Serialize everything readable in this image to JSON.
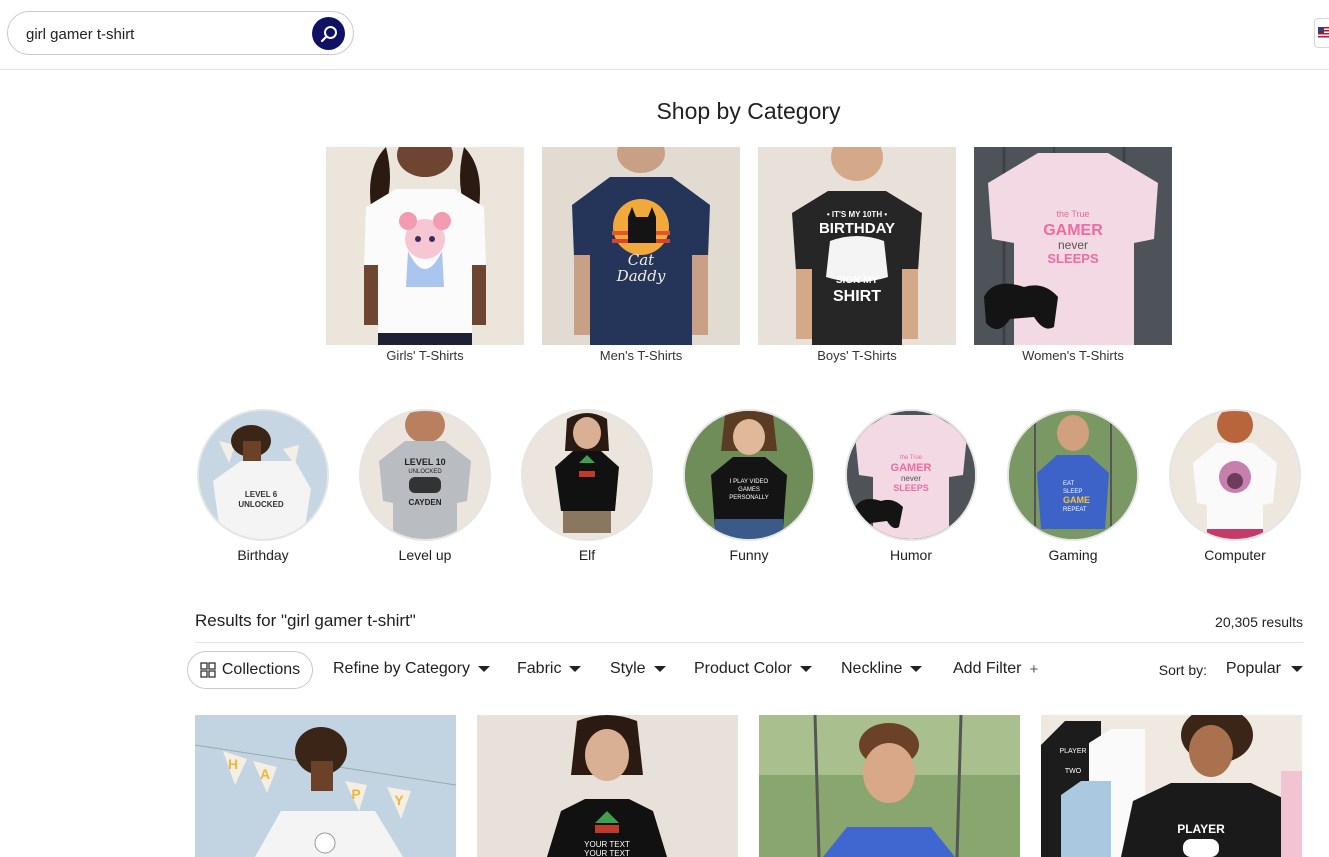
{
  "search": {
    "value": "girl gamer t-shirt",
    "button_icon": "search-icon"
  },
  "section": {
    "title": "Shop by Category"
  },
  "categories": [
    {
      "label": "Girls' T-Shirts"
    },
    {
      "label": "Men's T-Shirts"
    },
    {
      "label": "Boys' T-Shirts"
    },
    {
      "label": "Women's T-Shirts"
    }
  ],
  "collections_circles": [
    {
      "label": "Birthday"
    },
    {
      "label": "Level up"
    },
    {
      "label": "Elf"
    },
    {
      "label": "Funny"
    },
    {
      "label": "Humor"
    },
    {
      "label": "Gaming"
    },
    {
      "label": "Computer"
    }
  ],
  "results": {
    "title": "Results for \"girl gamer t-shirt\"",
    "count": "20,305 results"
  },
  "filters": {
    "collections": "Collections",
    "items": [
      "Refine by Category",
      "Fabric",
      "Style",
      "Product Color",
      "Neckline"
    ],
    "add_filter": "Add Filter",
    "add_symbol": "+",
    "sort_label": "Sort by:",
    "sort_value": "Popular"
  },
  "shirt_text": {
    "cat_daddy_1": "Cat",
    "cat_daddy_2": "Daddy",
    "bday_1": "• IT'S MY 10TH •",
    "bday_2": "BIRTHDAY",
    "bday_3": "SIGN MY",
    "bday_4": "SHIRT",
    "gamer_1": "the True",
    "gamer_2": "GAMER",
    "gamer_3": "never",
    "gamer_4": "SLEEPS",
    "level6_1": "LEVEL 6",
    "level6_2": "UNLOCKED",
    "level10_1": "LEVEL 10",
    "level10_2": "UNLOCKED",
    "level10_3": "CAYDEN",
    "elf_1": "YOUR TEXT",
    "elf_2": "YOUR TEXT",
    "funny_1": "I PLAY VIDEO",
    "funny_2": "GAMES",
    "funny_3": "PERSONALLY",
    "gaming_1": "EAT",
    "gaming_2": "SLEEP",
    "gaming_3": "GAME",
    "gaming_4": "REPEAT",
    "player_1": "PLAYER",
    "player_2": "TWO",
    "player_3": "PLAYER",
    "banner_1": "H",
    "banner_2": "A",
    "banner_3": "P",
    "banner_4": "Y"
  },
  "colors": {
    "search_button": "#0f1264",
    "accent_border": "#c9c9c9"
  }
}
